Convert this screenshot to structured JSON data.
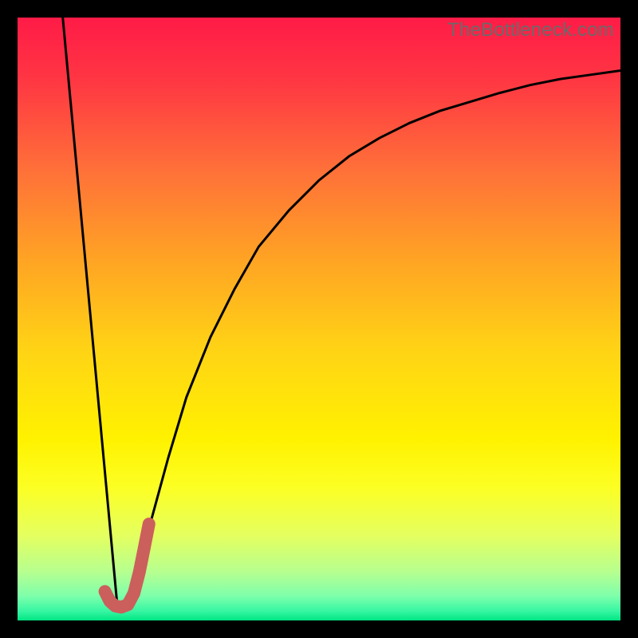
{
  "watermark": "TheBottleneck.com",
  "colors": {
    "frame": "#000000",
    "curve": "#000000",
    "highlight": "#cb5f5c",
    "gradient_stops": [
      {
        "pos": 0.0,
        "color": "#ff1b47"
      },
      {
        "pos": 0.1,
        "color": "#ff3543"
      },
      {
        "pos": 0.25,
        "color": "#ff6f39"
      },
      {
        "pos": 0.4,
        "color": "#ffa324"
      },
      {
        "pos": 0.55,
        "color": "#ffd315"
      },
      {
        "pos": 0.7,
        "color": "#fff200"
      },
      {
        "pos": 0.78,
        "color": "#fcff24"
      },
      {
        "pos": 0.86,
        "color": "#e4ff60"
      },
      {
        "pos": 0.92,
        "color": "#b6ff90"
      },
      {
        "pos": 0.96,
        "color": "#7dffab"
      },
      {
        "pos": 0.985,
        "color": "#35f6a2"
      },
      {
        "pos": 1.0,
        "color": "#00e582"
      }
    ]
  },
  "chart_data": {
    "type": "line",
    "title": "",
    "xlabel": "",
    "ylabel": "",
    "xlim": [
      0,
      100
    ],
    "ylim": [
      0,
      100
    ],
    "note": "y-axis inverted visually (0 at bottom = best/green, 100 at top = worst/red). Values estimated from pixel positions; no numeric axis labels present in image.",
    "series": [
      {
        "name": "left-line",
        "type": "line",
        "x": [
          7.5,
          16.5
        ],
        "y": [
          100,
          3
        ]
      },
      {
        "name": "right-curve",
        "type": "line",
        "x": [
          19,
          22,
          25,
          28,
          32,
          36,
          40,
          45,
          50,
          55,
          60,
          65,
          70,
          75,
          80,
          85,
          90,
          95,
          100
        ],
        "y": [
          6,
          16,
          27,
          37,
          47,
          55,
          62,
          68,
          73,
          77,
          80,
          82.5,
          84.5,
          86,
          87.5,
          88.8,
          89.8,
          90.5,
          91.2
        ]
      },
      {
        "name": "highlight-hook",
        "type": "line",
        "x": [
          14.5,
          15.3,
          16.2,
          17.2,
          18.3,
          19.3,
          20.2,
          21.0,
          21.8
        ],
        "y": [
          4.8,
          3.2,
          2.4,
          2.2,
          2.6,
          4.5,
          8.0,
          12.0,
          16.0
        ]
      }
    ]
  }
}
